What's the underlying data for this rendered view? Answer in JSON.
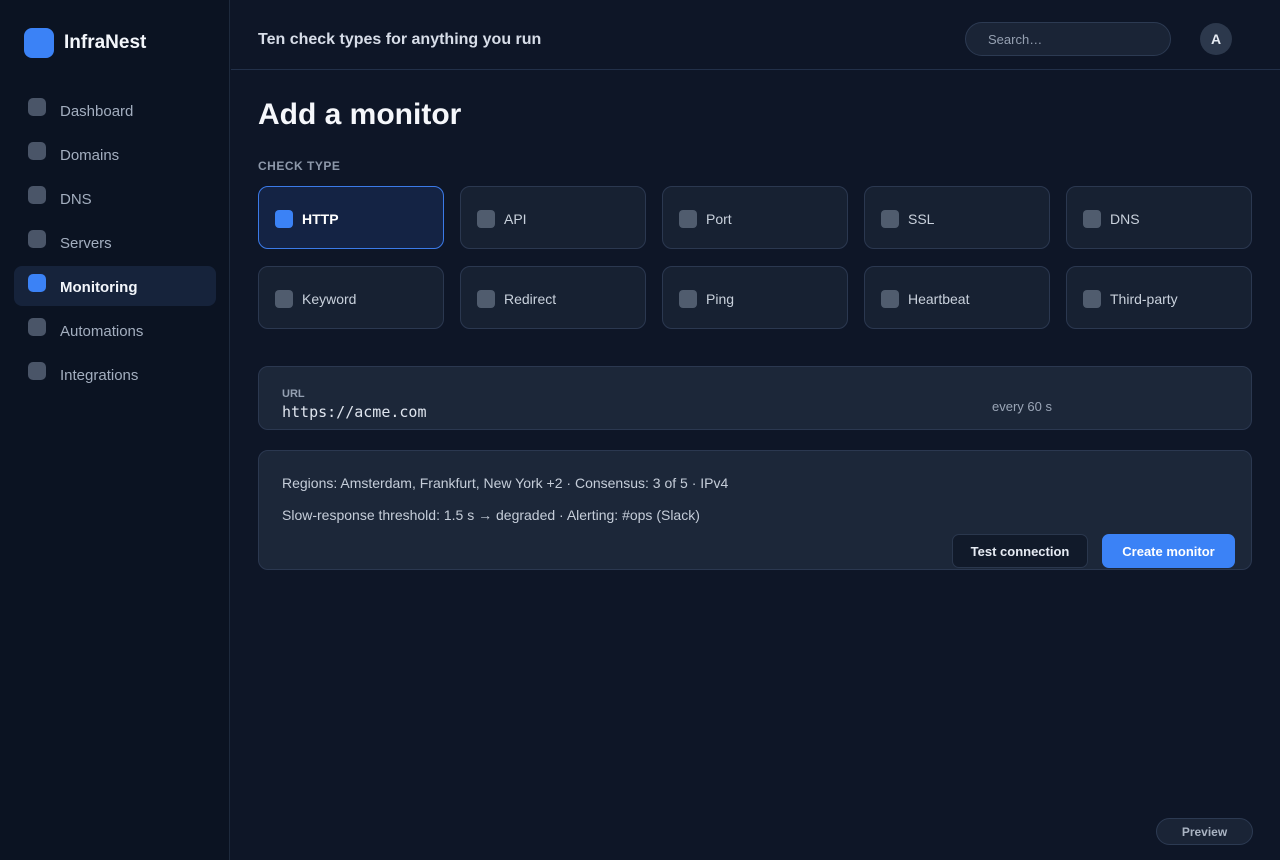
{
  "app": {
    "name": "InfraNest"
  },
  "sidebar": {
    "items": [
      {
        "label": "Dashboard",
        "icon": "dashboard-icon",
        "active": false
      },
      {
        "label": "Domains",
        "icon": "globe-icon",
        "active": false
      },
      {
        "label": "DNS",
        "icon": "dns-icon",
        "active": false
      },
      {
        "label": "Servers",
        "icon": "server-icon",
        "active": false
      },
      {
        "label": "Monitoring",
        "icon": "monitor-icon",
        "active": true
      },
      {
        "label": "Automations",
        "icon": "automation-icon",
        "active": false
      },
      {
        "label": "Integrations",
        "icon": "plug-icon",
        "active": false
      }
    ]
  },
  "header": {
    "title": "Ten check types for anything you run",
    "search_placeholder": "Search…",
    "avatar_initial": "A"
  },
  "main": {
    "title": "Add a monitor",
    "check_type_label": "CHECK TYPE",
    "check_types": [
      {
        "label": "HTTP",
        "selected": true
      },
      {
        "label": "API",
        "selected": false
      },
      {
        "label": "Port",
        "selected": false
      },
      {
        "label": "SSL",
        "selected": false
      },
      {
        "label": "DNS",
        "selected": false
      },
      {
        "label": "Keyword",
        "selected": false
      },
      {
        "label": "Redirect",
        "selected": false
      },
      {
        "label": "Ping",
        "selected": false
      },
      {
        "label": "Heartbeat",
        "selected": false
      },
      {
        "label": "Third-party",
        "selected": false
      }
    ],
    "url": {
      "label": "URL",
      "value": "https://acme.com",
      "interval": "every 60 s"
    },
    "config": {
      "regions_line": "Regions: Amsterdam, Frankfurt, New York +2 · Consensus: 3 of 5 · IPv4",
      "threshold_line": "Slow-response threshold: 1.5 s → degraded · Alerting: #ops (Slack)"
    },
    "buttons": {
      "test_label": "Test connection",
      "create_label": "Create monitor"
    }
  },
  "footer": {
    "preview_label": "Preview"
  },
  "colors": {
    "accent": "#3b82f6",
    "background": "#0e1627"
  }
}
